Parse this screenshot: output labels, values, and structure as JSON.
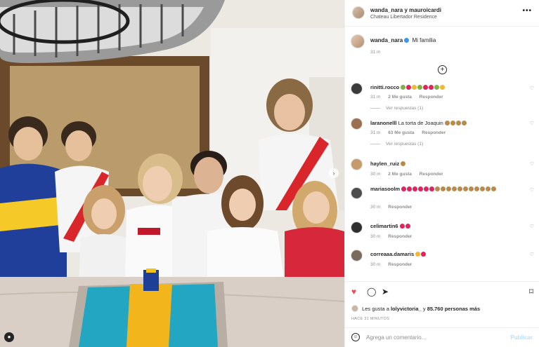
{
  "post": {
    "header_names": "wanda_nara y mauroicardi",
    "location": "Chateau Libertador Residence",
    "more": "•••",
    "caption_user": "wanda_nara",
    "caption_text": "Mi familia",
    "caption_time": "31 m"
  },
  "comments": [
    {
      "user": "rinitti.rocco",
      "text": "",
      "time": "31 m",
      "likes": "2 Me gusta",
      "reply": "Responder",
      "replies": "Ver respuestas (1)"
    },
    {
      "user": "laranonelll",
      "text": "La torta de Joaquin",
      "time": "31 m",
      "likes": "63 Me gusta",
      "reply": "Responder",
      "replies": "Ver respuestas (1)"
    },
    {
      "user": "haylen_ruiz",
      "text": "",
      "time": "30 m",
      "likes": "2 Me gusta",
      "reply": "Responder"
    },
    {
      "user": "mariasoolm",
      "text": "",
      "time": "30 m",
      "reply": "Responder"
    },
    {
      "user": "celimartin6",
      "text": "",
      "time": "30 m",
      "reply": "Responder"
    },
    {
      "user": "correaaa.damaris",
      "text": "",
      "time": "30 m",
      "reply": "Responder"
    }
  ],
  "actions": {
    "like_icon": "heart-filled",
    "comment_icon": "speech-bubble",
    "share_icon": "paper-plane",
    "save_icon": "bookmark"
  },
  "likes_line": {
    "prefix": "Les gusta a",
    "user": "lolyvictoria_",
    "middle": "y",
    "count": "85.760 personas más"
  },
  "time_ago": "HACE 31 MINUTOS",
  "add_comment": {
    "placeholder": "Agrega un comentario...",
    "post": "Publicar"
  },
  "photo_labels": {
    "boca_sponsor": "QATAR",
    "river_sponsor": "TURKISH AIRLINES",
    "kid_sponsor": "TURK AIRL",
    "mom_shirt": "boss"
  },
  "colors": {
    "accent_blue": "#3897f0",
    "like_red": "#ed4956",
    "post_disabled": "#b2dffc"
  }
}
